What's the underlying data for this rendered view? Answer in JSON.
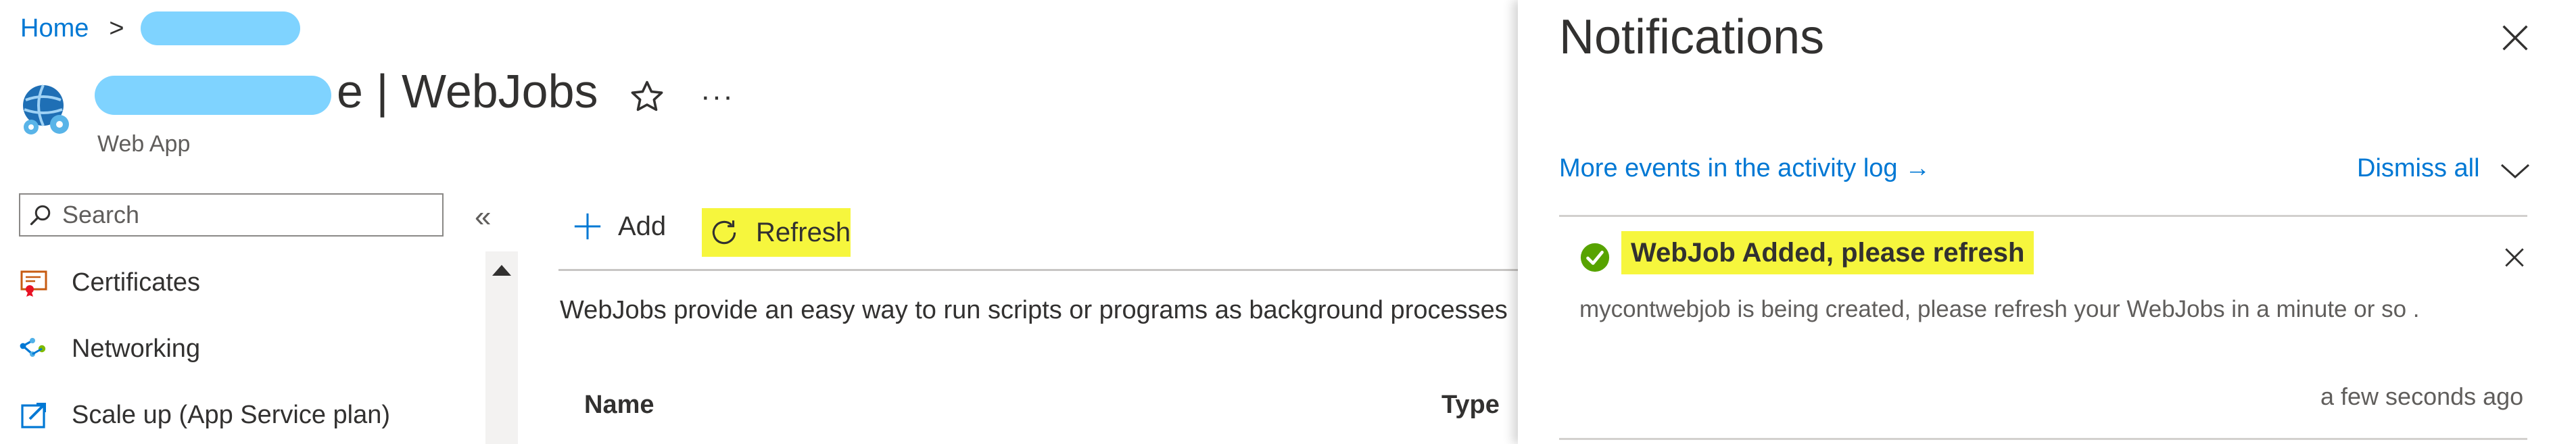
{
  "breadcrumb": {
    "home": "Home",
    "separator": ">"
  },
  "header": {
    "title": "e | WebJobs",
    "subtitle": "Web App",
    "more_label": "···"
  },
  "sidebar": {
    "search": {
      "placeholder": "Search"
    },
    "collapse_label": "«",
    "items": [
      {
        "label": "Certificates",
        "icon": "certificate-icon"
      },
      {
        "label": "Networking",
        "icon": "networking-icon"
      },
      {
        "label": "Scale up (App Service plan)",
        "icon": "scale-up-icon"
      }
    ]
  },
  "toolbar": {
    "add_label": "Add",
    "refresh_label": "Refresh"
  },
  "main": {
    "description": "WebJobs provide an easy way to run scripts or programs as background processes",
    "columns": {
      "name": "Name",
      "type": "Type"
    }
  },
  "notifications": {
    "title": "Notifications",
    "activity_link": "More events in the activity log →",
    "dismiss_all": "Dismiss all",
    "items": [
      {
        "status": "success",
        "title": "WebJob Added, please refresh",
        "message": "mycontwebjob is being created, please refresh your WebJobs in a minute or so .",
        "time": "a few seconds ago"
      }
    ]
  },
  "colors": {
    "link": "#0078d4",
    "highlight": "#f6f63d",
    "success": "#57a300",
    "redaction": "#7fd3ff"
  }
}
